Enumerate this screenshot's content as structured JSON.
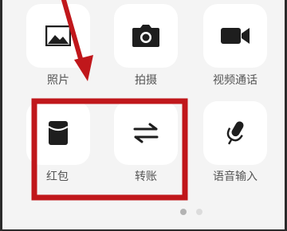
{
  "panel": {
    "items": [
      {
        "label": "照片",
        "icon": "photo-icon"
      },
      {
        "label": "拍摄",
        "icon": "camera-icon"
      },
      {
        "label": "视频通话",
        "icon": "video-call-icon"
      },
      {
        "label": "红包",
        "icon": "red-packet-icon"
      },
      {
        "label": "转账",
        "icon": "transfer-icon"
      },
      {
        "label": "语音输入",
        "icon": "microphone-icon"
      }
    ]
  },
  "page_indicator": {
    "total": 2,
    "current": 1
  },
  "colors": {
    "background": "#f4f4f4",
    "tile": "#ffffff",
    "icon": "#1e1e1e",
    "label": "#555555",
    "annotation": "#c0171b",
    "dot_active": "#b3b3b3",
    "dot_inactive": "#dcdcdc"
  }
}
